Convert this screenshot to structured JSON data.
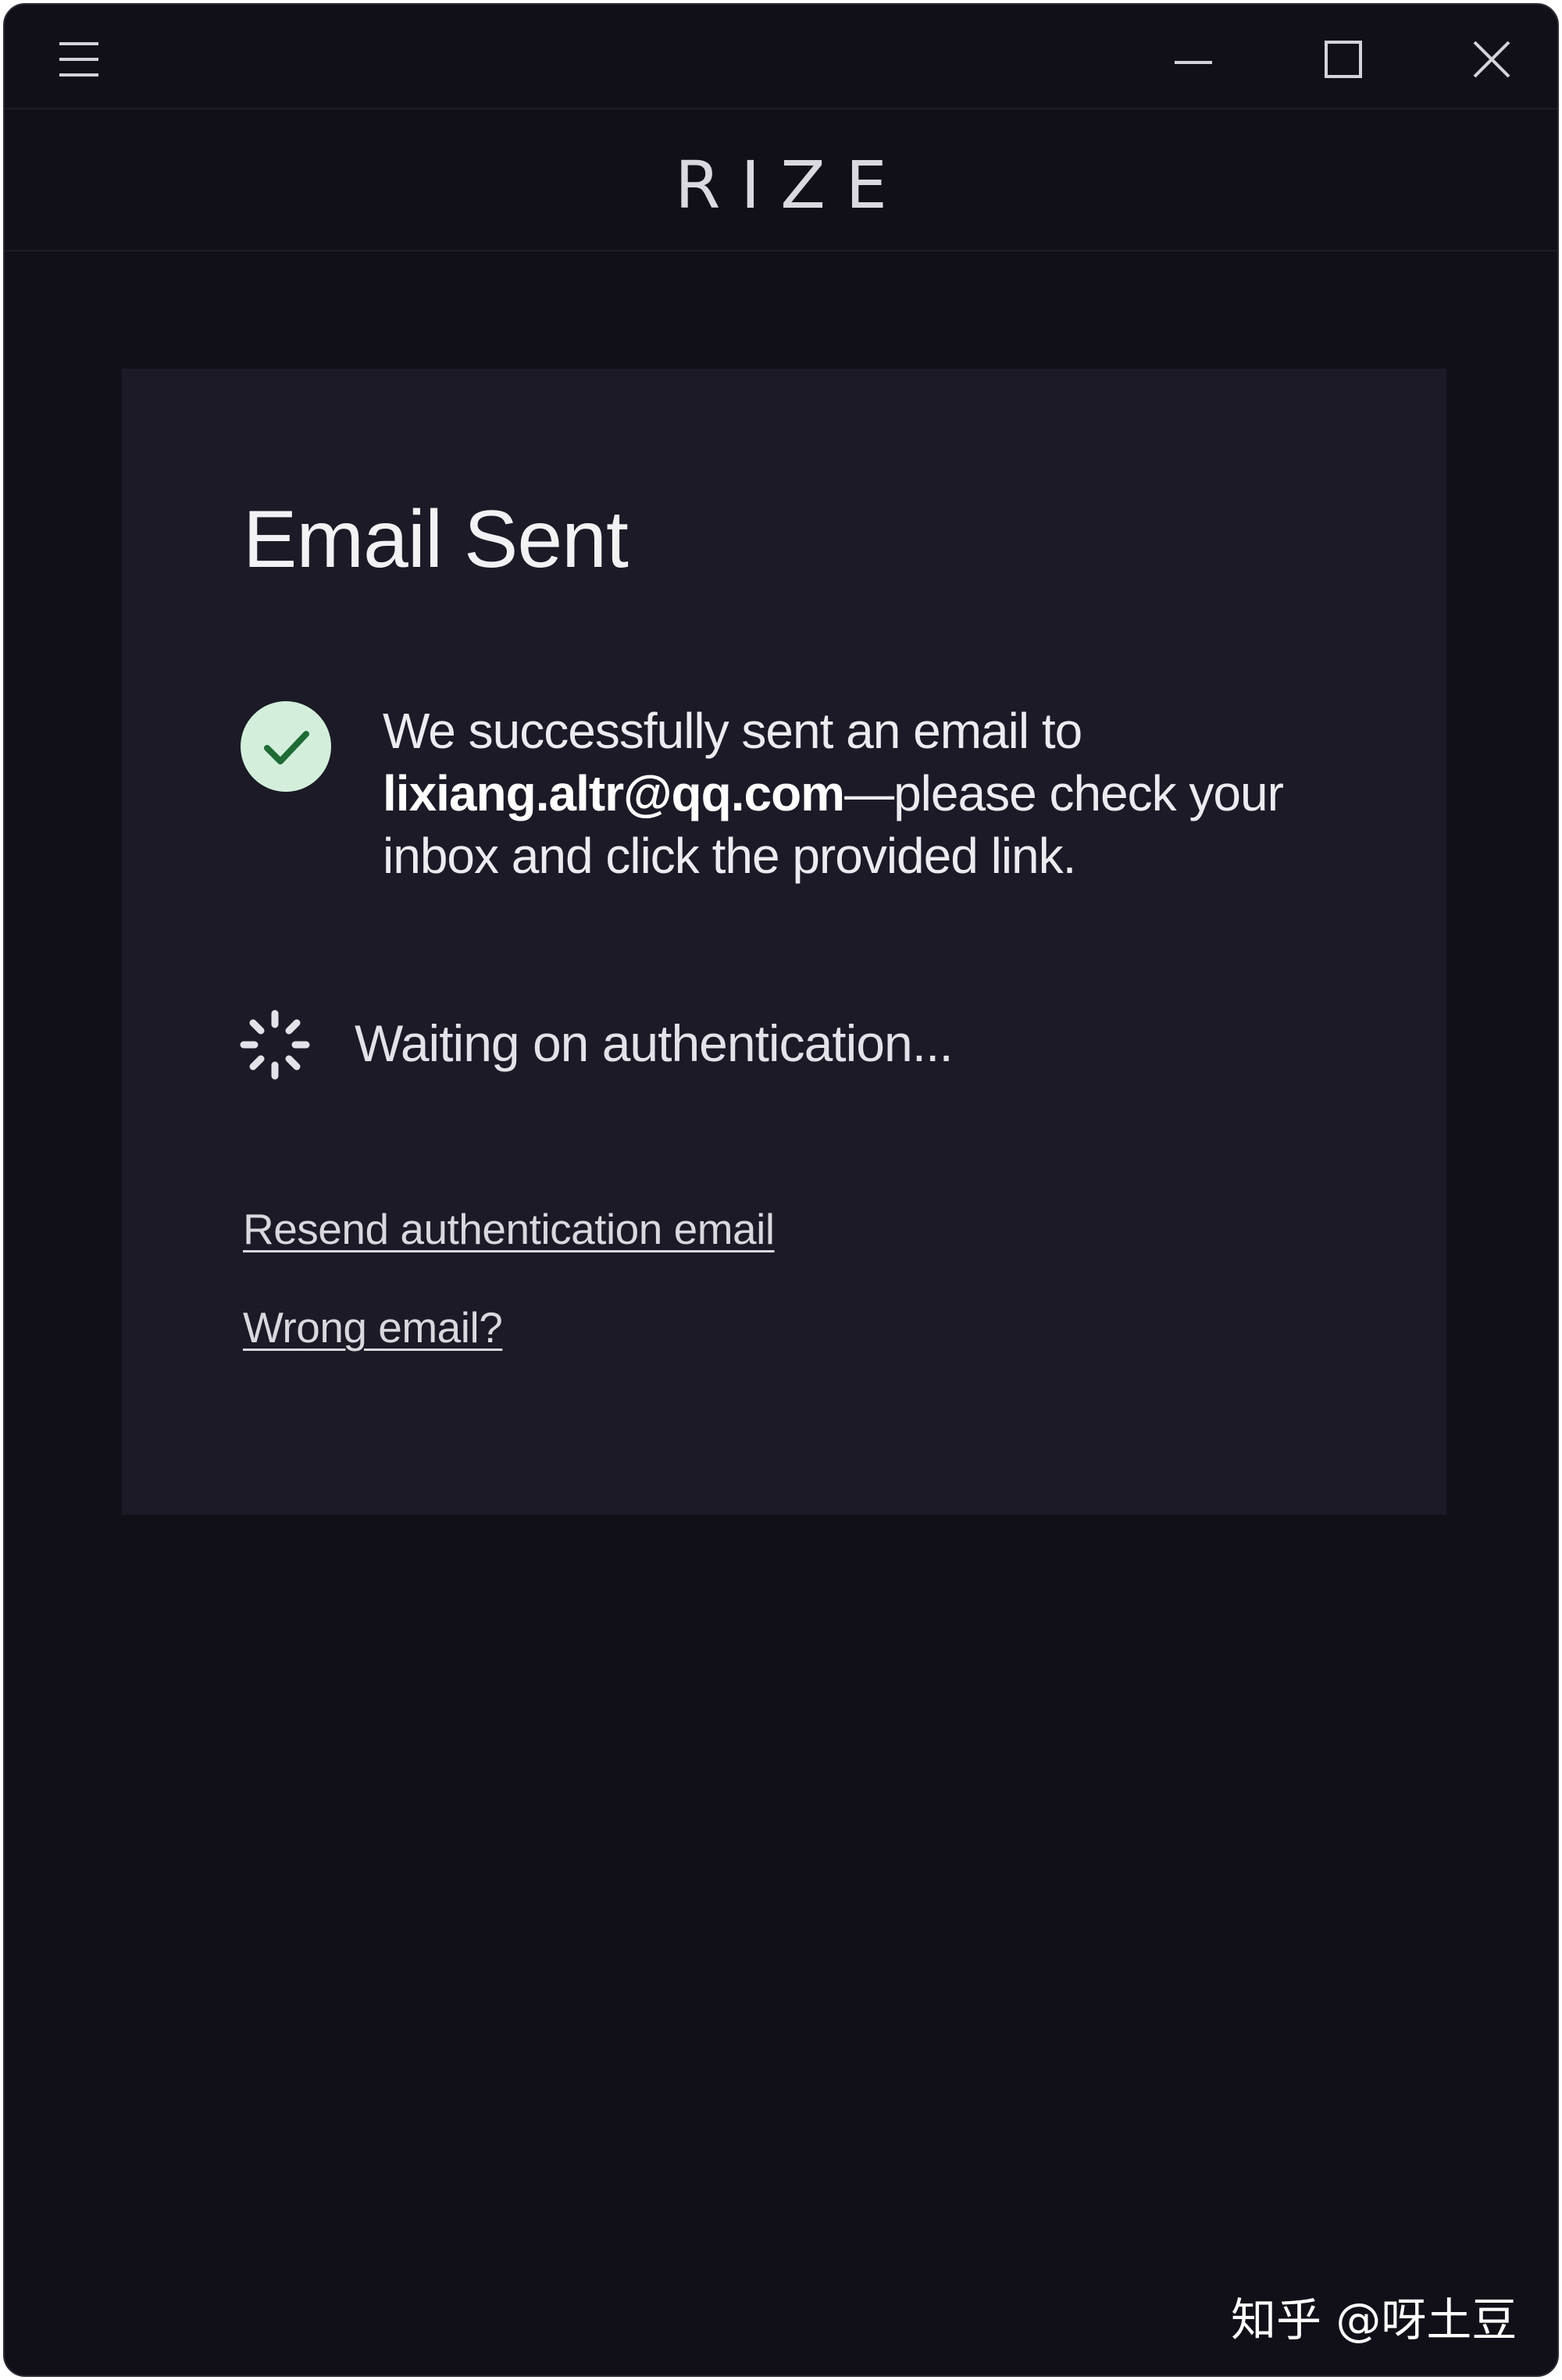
{
  "window": {
    "controls": {
      "menu_icon": "hamburger-menu-icon",
      "minimize_icon": "minimize-icon",
      "maximize_icon": "maximize-icon",
      "close_icon": "close-icon"
    }
  },
  "brand": {
    "name": "RIZE"
  },
  "card": {
    "title": "Email Sent",
    "message": {
      "prefix": "We successfully sent an email to",
      "email": "lixiang.altr@qq.com",
      "suffix": "—please check your inbox and click the provided link."
    },
    "status": "Waiting on authentication...",
    "links": {
      "resend": "Resend authentication email",
      "wrong_email": "Wrong email?"
    }
  },
  "watermark": "知乎 @呀土豆",
  "colors": {
    "background": "#111019",
    "card": "#1b1a26",
    "success_badge": "#d3efdc",
    "success_check": "#1f6b35",
    "text": "#ecebf0"
  }
}
